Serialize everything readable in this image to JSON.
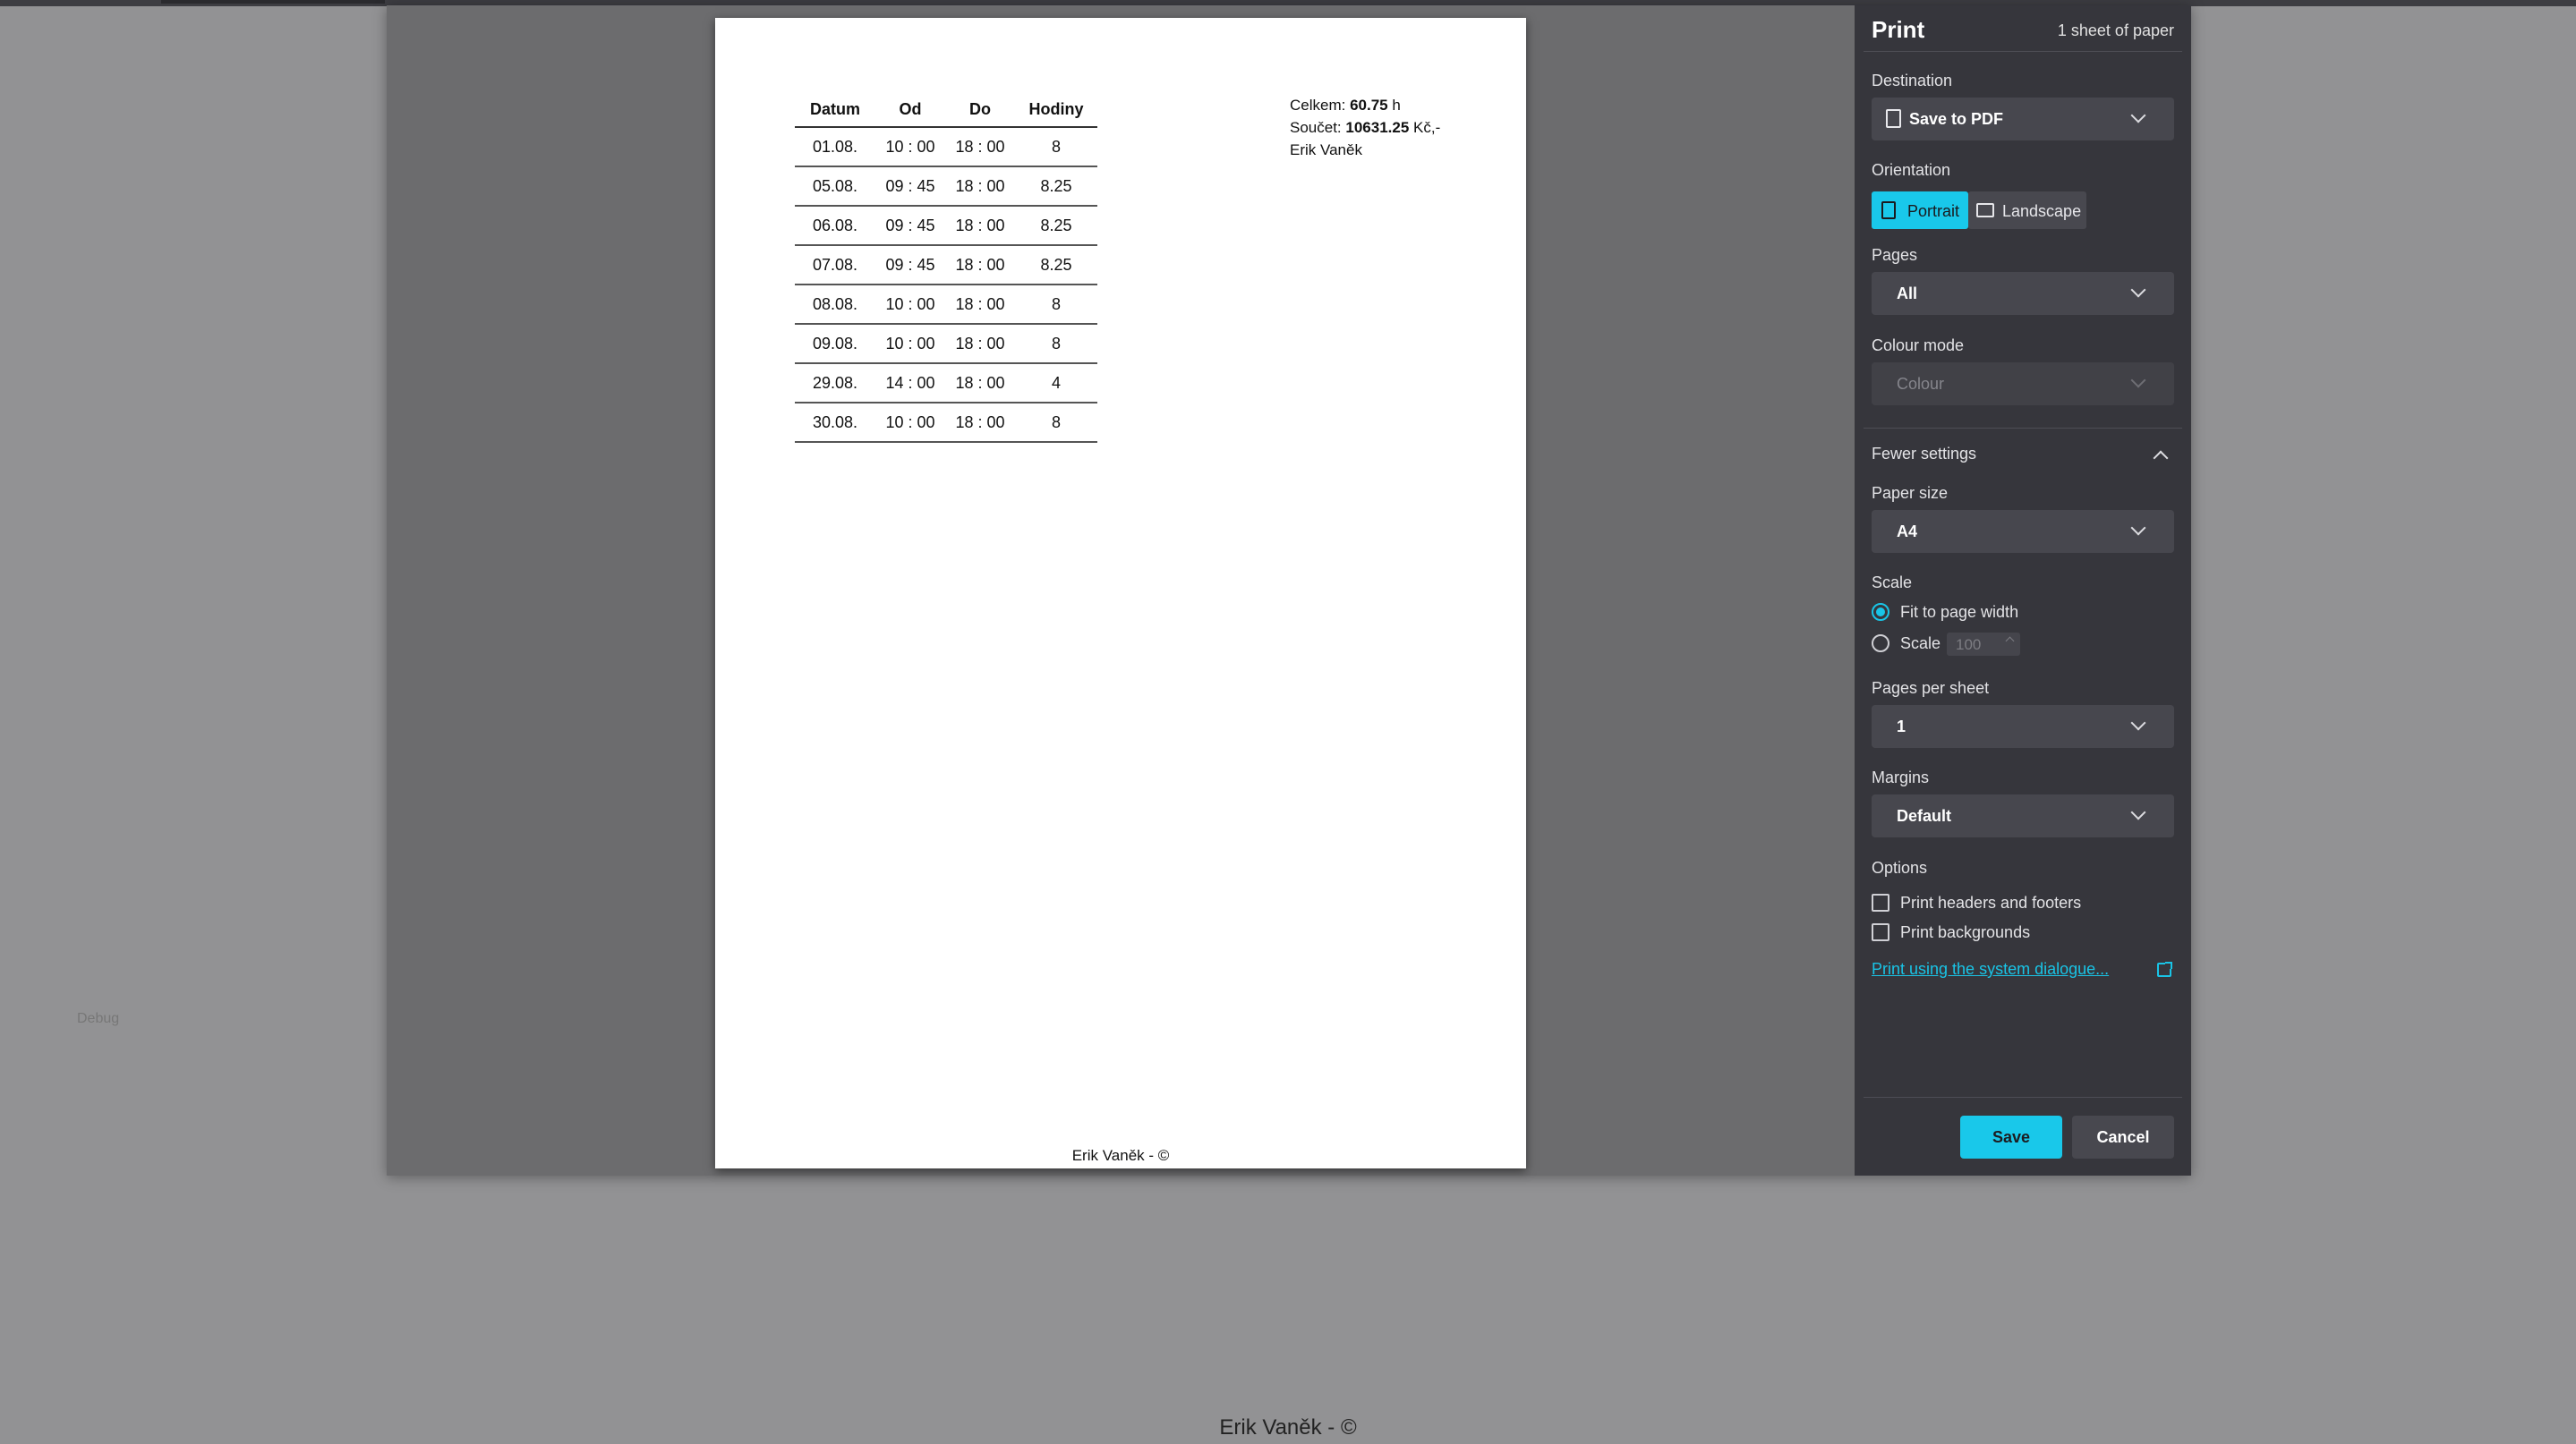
{
  "page": {
    "footer": "Erik Vaněk - ©",
    "debug_label": "Debug"
  },
  "document": {
    "table": {
      "headers": [
        "Datum",
        "Od",
        "Do",
        "Hodiny"
      ],
      "rows": [
        [
          "01.08.",
          "10 : 00",
          "18 : 00",
          "8"
        ],
        [
          "05.08.",
          "09 : 45",
          "18 : 00",
          "8.25"
        ],
        [
          "06.08.",
          "09 : 45",
          "18 : 00",
          "8.25"
        ],
        [
          "07.08.",
          "09 : 45",
          "18 : 00",
          "8.25"
        ],
        [
          "08.08.",
          "10 : 00",
          "18 : 00",
          "8"
        ],
        [
          "09.08.",
          "10 : 00",
          "18 : 00",
          "8"
        ],
        [
          "29.08.",
          "14 : 00",
          "18 : 00",
          "4"
        ],
        [
          "30.08.",
          "10 : 00",
          "18 : 00",
          "8"
        ]
      ]
    },
    "summary": {
      "total_label": "Celkem:",
      "total_value": "60.75",
      "total_unit": "h",
      "sum_label": "Součet:",
      "sum_value": "10631.25",
      "sum_unit": "Kč,-",
      "name": "Erik Vaněk"
    },
    "footer": "Erik Vaněk - ©"
  },
  "print_panel": {
    "title": "Print",
    "sheets": "1 sheet of paper",
    "destination": {
      "label": "Destination",
      "value": "Save to PDF",
      "icon": "document-icon"
    },
    "orientation": {
      "label": "Orientation",
      "portrait": "Portrait",
      "landscape": "Landscape",
      "selected": "Portrait"
    },
    "pages": {
      "label": "Pages",
      "value": "All"
    },
    "colour_mode": {
      "label": "Colour mode",
      "value": "Colour",
      "disabled": true
    },
    "fewer_settings": "Fewer settings",
    "paper_size": {
      "label": "Paper size",
      "value": "A4"
    },
    "scale": {
      "label": "Scale",
      "fit_option": "Fit to page width",
      "scale_option": "Scale",
      "scale_value": "100",
      "selected": "Fit to page width"
    },
    "pages_per_sheet": {
      "label": "Pages per sheet",
      "value": "1"
    },
    "margins": {
      "label": "Margins",
      "value": "Default"
    },
    "options": {
      "label": "Options",
      "headers_footers": "Print headers and footers",
      "backgrounds": "Print backgrounds",
      "headers_footers_checked": false,
      "backgrounds_checked": false
    },
    "system_dialog_link": "Print using the system dialogue...",
    "save_button": "Save",
    "cancel_button": "Cancel"
  },
  "colors": {
    "accent": "#19c4e6",
    "panel_bg": "#36363c",
    "preview_bg": "#6c6c6e",
    "page_bg": "#929294"
  }
}
